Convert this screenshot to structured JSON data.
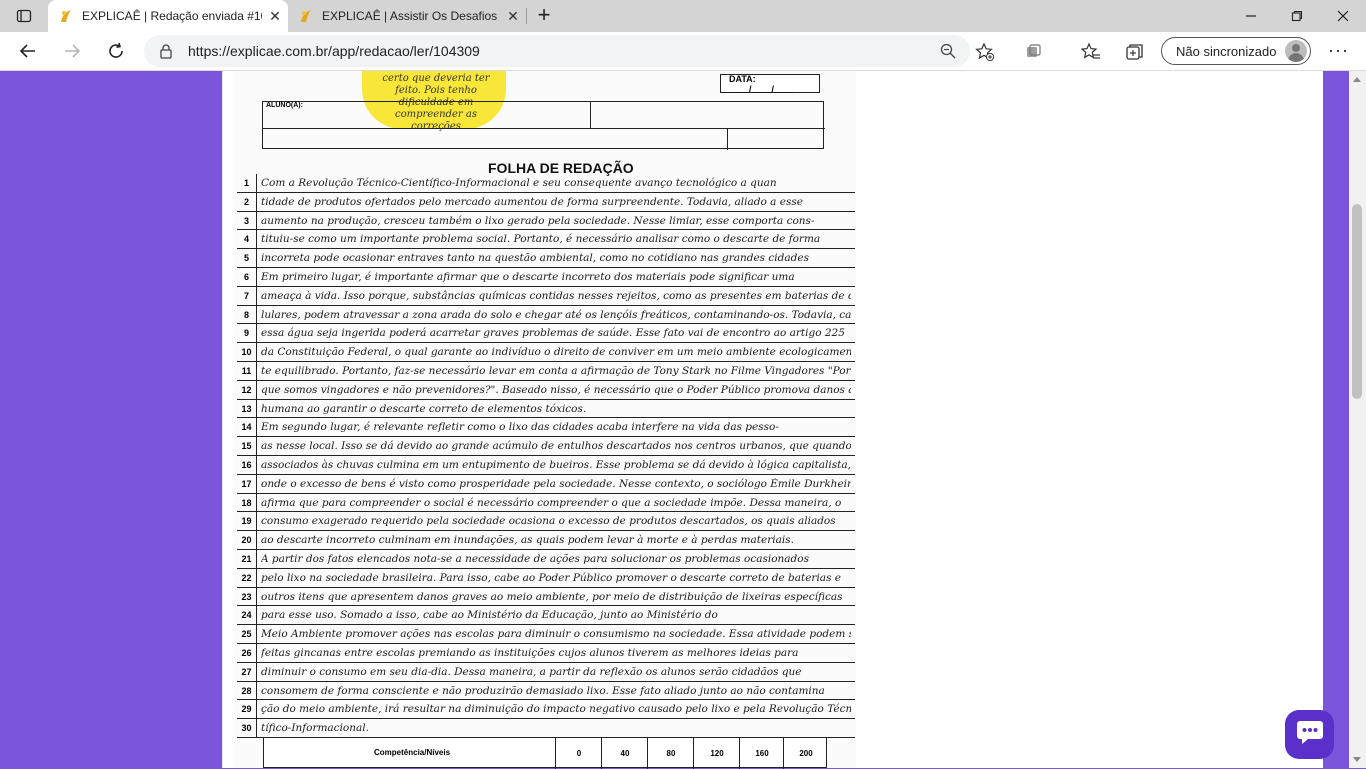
{
  "browser": {
    "tabs": [
      {
        "title": "EXPLICAÊ | Redação enviada #10",
        "active": true
      },
      {
        "title": "EXPLICAÊ | Assistir Os Desafios p",
        "active": false
      }
    ],
    "url": "https://explicae.com.br/app/redacao/ler/104309",
    "sync_label": "Não sincronizado",
    "icons": [
      "tab-actions-icon",
      "back-icon",
      "forward-icon",
      "refresh-icon",
      "lock-icon",
      "zoom-icon",
      "add-favorite-icon",
      "extension-icon",
      "favorites-icon",
      "collections-icon",
      "more-icon",
      "minimize-icon",
      "maximize-icon",
      "close-icon"
    ]
  },
  "sheet": {
    "sticky_note": "certo que deveria ter feito. Pois tenho dificuldade em compreender as correções",
    "data_label": "DATA: ____/____/____",
    "aluno_label": "ALUNO(A):",
    "title": "FOLHA DE REDAÇÃO",
    "lines": [
      {
        "n": "1",
        "text": "Com a Revolução Técnico-Científico-Informacional e seu consequente avanço tecnológico a quan"
      },
      {
        "n": "2",
        "text": "tidade de produtos ofertados pelo mercado aumentou de forma surpreendente. Todavia, aliado a esse"
      },
      {
        "n": "3",
        "text": "aumento na produção, cresceu também o lixo gerado pela sociedade. Nesse limiar, esse comporta cons-"
      },
      {
        "n": "4",
        "text": "tituiu-se como um importante problema social. Portanto, é necessário analisar como o descarte de forma"
      },
      {
        "n": "5",
        "text": "incorreta pode ocasionar entraves tanto na questão ambiental, como no cotidiano nas grandes cidades"
      },
      {
        "n": "6",
        "text": "Em primeiro lugar, é importante afirmar que o descarte incorreto dos materiais pode significar uma"
      },
      {
        "n": "7",
        "text": "ameaça à vida. Isso porque, substâncias químicas contidas nesses rejeitos, como as presentes em baterias de ce-"
      },
      {
        "n": "8",
        "text": "lulares, podem atravessar a zona arada do solo e chegar até os lençóis freáticos, contaminando-os. Todavia, caso"
      },
      {
        "n": "9",
        "text": "essa água seja ingerida poderá acarretar graves problemas de saúde. Esse fato vai de encontro ao artigo 225"
      },
      {
        "n": "10",
        "text": "da Constituição Federal, o qual garante ao indivíduo o direito de conviver em um meio ambiente ecologicamen"
      },
      {
        "n": "11",
        "text": "te equilibrado. Portanto, faz-se necessário levar em conta a afirmação de Tony Stark no Filme Vingadores \"Por"
      },
      {
        "n": "12",
        "text": "que somos vingadores e não prevenidores?\". Baseado nisso, é necessário que o Poder Público promova danos à saúde"
      },
      {
        "n": "13",
        "text": "humana ao garantir o descarte correto de elementos tóxicos."
      },
      {
        "n": "14",
        "text": "Em segundo lugar, é relevante refletir como o lixo das cidades acaba interfere na vida das pesso-"
      },
      {
        "n": "15",
        "text": "as nesse local. Isso se dá devido ao grande acúmulo de entulhos descartados nos centros urbanos, que quando"
      },
      {
        "n": "16",
        "text": "associados às chuvas culmina em um entupimento de bueiros. Esse problema se dá devido à lógica capitalista,"
      },
      {
        "n": "17",
        "text": "onde o excesso de bens é visto como prosperidade pela sociedade. Nesse contexto, o sociólogo Émile Durkheim"
      },
      {
        "n": "18",
        "text": "afirma que para compreender o social é necessário compreender o que a sociedade impõe. Dessa maneira, o"
      },
      {
        "n": "19",
        "text": "consumo exagerado requerido pela sociedade ocasiona o excesso de produtos descartados, os quais aliados"
      },
      {
        "n": "20",
        "text": "ao descarte incorreto culminam em inundações, as quais podem levar à morte e à perdas materiais."
      },
      {
        "n": "21",
        "text": "A partir dos fatos elencados nota-se a necessidade de ações para solucionar os problemas ocasionados"
      },
      {
        "n": "22",
        "text": "pelo lixo na sociedade brasileira. Para isso, cabe ao Poder Público promover o descarte correto de baterias e"
      },
      {
        "n": "23",
        "text": "outros itens que apresentem danos graves ao meio ambiente, por meio de distribuição de lixeiras específicas"
      },
      {
        "n": "24",
        "text": "para esse uso. Somado a isso, cabe ao Ministério da Educação, junto ao Ministério do"
      },
      {
        "n": "25",
        "text": "Meio Ambiente promover ações nas escolas para diminuir o consumismo na sociedade. Essa atividade podem ser"
      },
      {
        "n": "26",
        "text": "feitas gincanas entre escolas premiando as instituições cujos alunos tiverem as melhores ideias para"
      },
      {
        "n": "27",
        "text": "diminuir o consumo em seu dia-dia. Dessa maneira, a partir da reflexão os alunos serão cidadãos que"
      },
      {
        "n": "28",
        "text": "consomem de forma consciente e não produzirão demasiado lixo. Esse fato aliado junto ao não contamina"
      },
      {
        "n": "29",
        "text": "ção do meio ambiente, irá resultar na diminuição do impacto negativo causado pelo lixo e pela Revolução Técnico-Cien-"
      },
      {
        "n": "30",
        "text": "tífico-Informacional."
      }
    ],
    "grade_table": {
      "label": "Competência/Níveis",
      "levels": [
        "0",
        "40",
        "80",
        "120",
        "160",
        "200"
      ]
    }
  },
  "chat_button": {
    "icon": "chat-icon"
  }
}
